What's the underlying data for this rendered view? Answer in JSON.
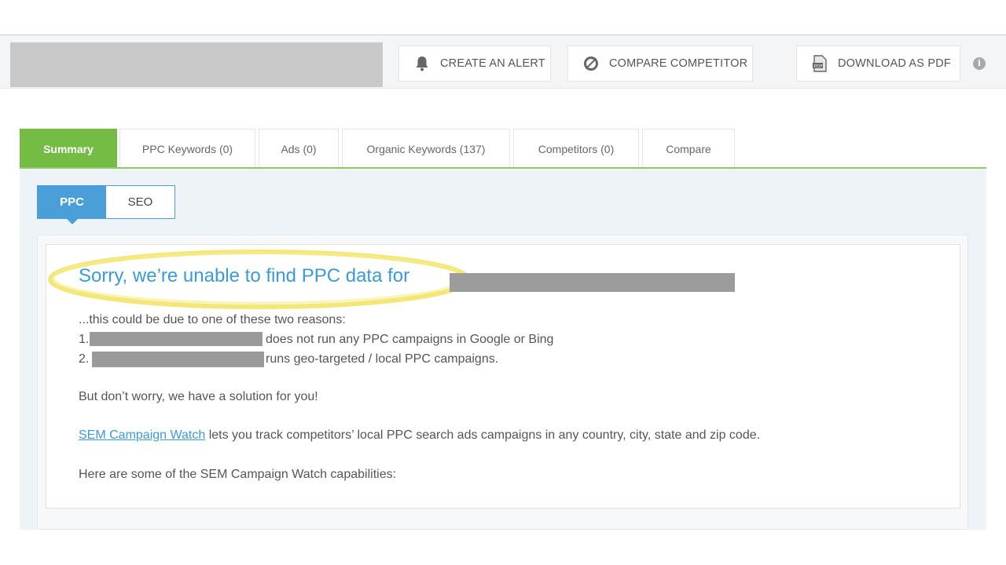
{
  "toolbar": {
    "buttons": [
      {
        "label": "CREATE AN ALERT",
        "icon": "bell-icon"
      },
      {
        "label": "COMPARE COMPETITOR",
        "icon": "compare-icon"
      },
      {
        "label": "DOWNLOAD AS PDF",
        "icon": "pdf-icon"
      }
    ],
    "info_glyph": "i"
  },
  "tabs": [
    {
      "label": "Summary",
      "active": true
    },
    {
      "label": "PPC Keywords (0)"
    },
    {
      "label": "Ads (0)"
    },
    {
      "label": "Organic Keywords (137)"
    },
    {
      "label": "Competitors (0)"
    },
    {
      "label": "Compare"
    }
  ],
  "toggle": {
    "options": [
      "PPC",
      "SEO"
    ],
    "selected": "PPC"
  },
  "message": {
    "heading": "Sorry, we’re unable to find PPC data for",
    "intro": "...this could be due to one of these two reasons:",
    "reason1_num": "1.",
    "reason1_text": "does not run any PPC campaigns in Google or Bing",
    "reason2_num": "2.",
    "reason2_text": "runs geo-targeted / local PPC campaigns.",
    "reassure": "But don’t worry, we have a solution for you!",
    "link_text": "SEM Campaign Watch",
    "link_rest": " lets you track competitors’ local PPC search ads campaigns in any country, city, state and zip code.",
    "capabilities": "Here are some of the SEM Campaign Watch capabilities:"
  },
  "colors": {
    "accent_green": "#75bc45",
    "accent_blue": "#4a9fd8",
    "highlight_yellow": "#f2e46a"
  }
}
